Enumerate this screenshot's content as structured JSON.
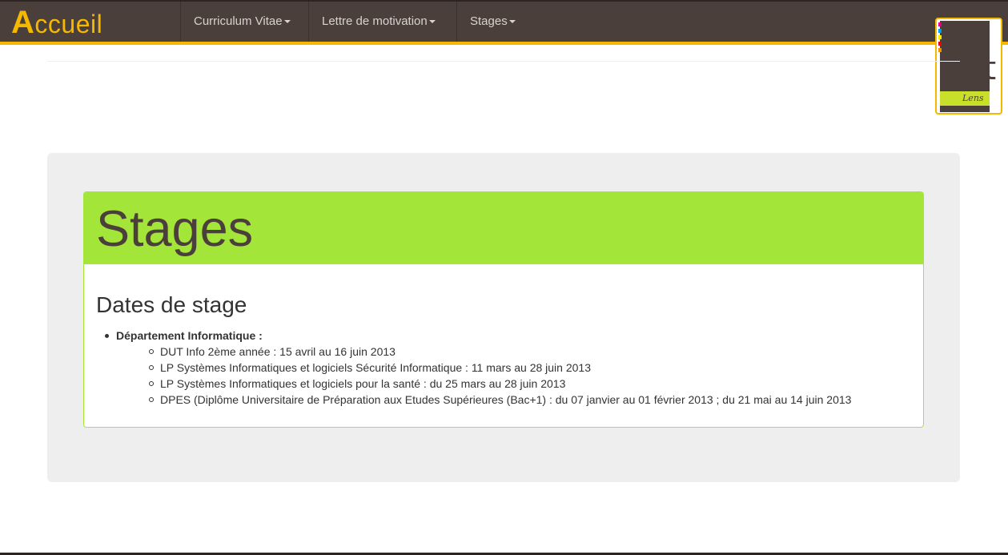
{
  "navbar": {
    "brand_first": "A",
    "brand_rest": "ccueil",
    "items": [
      {
        "label": "Curriculum Vitae"
      },
      {
        "label": "Lettre de motivation"
      },
      {
        "label": "Stages"
      }
    ]
  },
  "logo": {
    "text": "iut",
    "subtext": "Lens"
  },
  "main": {
    "panel_title": "Stages",
    "section_title": "Dates de stage",
    "department": "Département Informatique :",
    "entries": [
      "DUT Info 2ème année : 15 avril au 16 juin 2013",
      "LP Systèmes Informatiques et logiciels Sécurité Informatique : 11 mars au 28 juin 2013",
      "LP Systèmes Informatiques et logiciels pour la santé : du 25 mars au 28 juin 2013",
      "DPES (Diplôme Universitaire de Préparation aux Etudes Supérieures (Bac+1) : du 07 janvier au 01 février 2013 ; du 21 mai au 14 juin 2013"
    ]
  },
  "colors": {
    "navbar_bg": "#4a3f3a",
    "accent": "#f4b800",
    "panel_heading": "#a4e53a",
    "jumbotron": "#eeeeee"
  }
}
